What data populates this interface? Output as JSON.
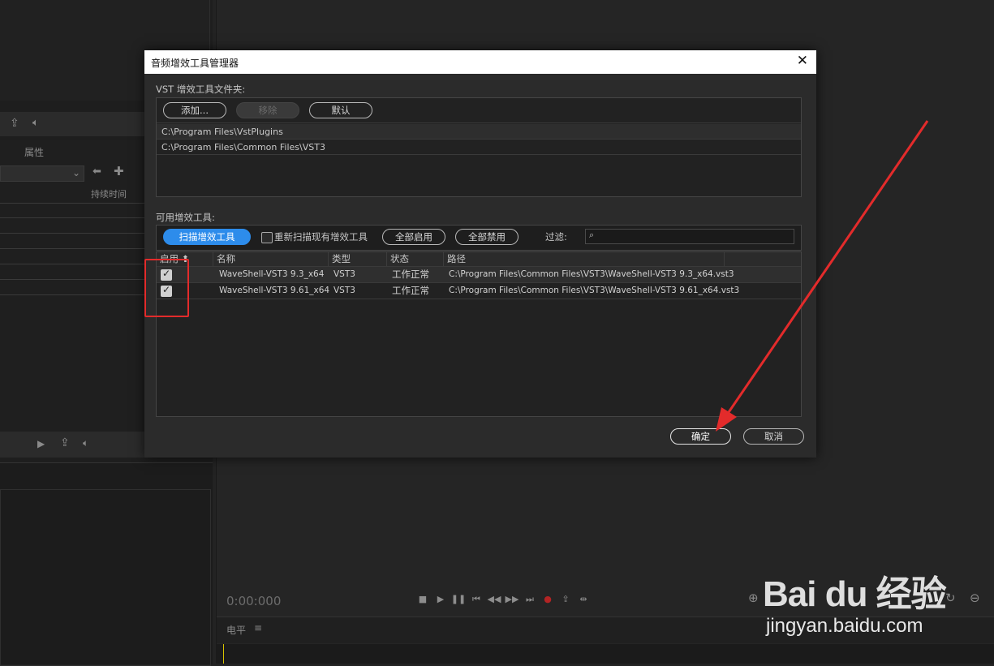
{
  "dialog": {
    "title": "音频增效工具管理器",
    "vst_folder_label": "VST 增效工具文件夹:",
    "add_label": "添加...",
    "remove_label": "移除",
    "default_label": "默认",
    "folders": [
      "C:\\Program Files\\VstPlugins",
      "C:\\Program Files\\Common Files\\VST3"
    ],
    "available_label": "可用增效工具:",
    "scan_label": "扫描增效工具",
    "rescan_label": "重新扫描现有增效工具",
    "rescan_checked": false,
    "enable_all_label": "全部启用",
    "disable_all_label": "全部禁用",
    "filter_label": "过滤:",
    "filter_value": "",
    "columns": {
      "enabled": "启用",
      "name": "名称",
      "type": "类型",
      "status": "状态",
      "path": "路径"
    },
    "plugins": [
      {
        "enabled": true,
        "name": "WaveShell-VST3 9.3_x64",
        "type": "VST3",
        "status": "工作正常",
        "path": "C:\\Program Files\\Common Files\\VST3\\WaveShell-VST3 9.3_x64.vst3"
      },
      {
        "enabled": true,
        "name": "WaveShell-VST3 9.61_x64",
        "type": "VST3",
        "status": "工作正常",
        "path": "C:\\Program Files\\Common Files\\VST3\\WaveShell-VST3 9.61_x64.vst3"
      }
    ],
    "ok_label": "确定",
    "cancel_label": "取消"
  },
  "background": {
    "properties_label": "属性",
    "duration_label": "持续时间",
    "timecode": "0:00:000",
    "level_label": "电平"
  },
  "watermark": {
    "text": "Bai du 经验",
    "url": "jingyan.baidu.com"
  },
  "colors": {
    "accent": "#2d8ceb",
    "annotation": "#e32b2b",
    "panel": "#2b2b2b"
  }
}
